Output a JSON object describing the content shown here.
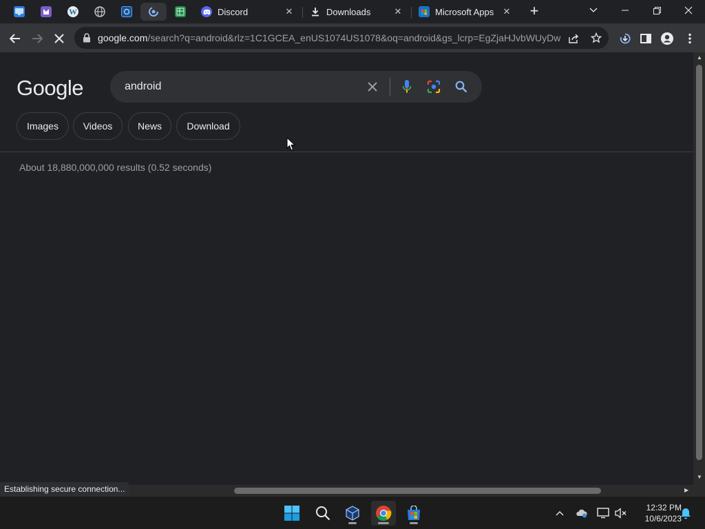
{
  "colors": {
    "discord": "#5865f2",
    "omnibox_bg": "#202124",
    "toolbar_bg": "#35363a",
    "page_bg": "#202124",
    "google_blue": "#8ab4f8"
  },
  "tabs": {
    "pinned": [
      {
        "name": "pinned-tab-remote-desktop",
        "icon": "remote-desktop-icon"
      },
      {
        "name": "pinned-tab-app",
        "icon": "purple-app-icon"
      },
      {
        "name": "pinned-tab-wordpress",
        "icon": "wordpress-icon"
      },
      {
        "name": "pinned-tab-globe",
        "icon": "globe-icon"
      },
      {
        "name": "pinned-tab-settings",
        "icon": "blue-app-icon"
      },
      {
        "name": "pinned-tab-loading",
        "icon": "loading-icon"
      },
      {
        "name": "pinned-tab-spreadsheet",
        "icon": "spreadsheet-icon"
      }
    ],
    "open": [
      {
        "title": "Discord",
        "icon": "discord-icon"
      },
      {
        "title": "Downloads",
        "icon": "download-icon"
      },
      {
        "title": "Microsoft Apps",
        "icon": "microsoft-store-icon"
      }
    ]
  },
  "toolbar": {
    "url_host": "google.com",
    "url_rest": "/search?q=android&rlz=1C1GCEA_enUS1074US1078&oq=android&gs_lcrp=EgZjaHJvbWUyDw..."
  },
  "page": {
    "logo": "Google",
    "query": "android",
    "chips": [
      "Images",
      "Videos",
      "News",
      "Download"
    ],
    "stats": "About 18,880,000,000 results (0.52 seconds)"
  },
  "status": "Establishing secure connection...",
  "taskbar": {
    "time": "12:32 PM",
    "date": "10/6/2023"
  }
}
